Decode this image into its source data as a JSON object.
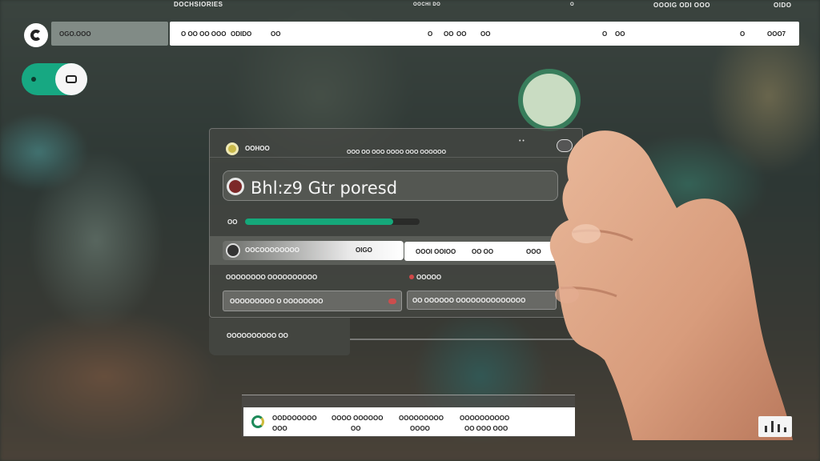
{
  "top_strip": {
    "left_title": "DOCHSIORIES",
    "center_text": "OOCHI DO",
    "center_dot": "O",
    "right_text": "OOOIG ODI OOO",
    "far_right": "OIDO"
  },
  "header": {
    "tag_label": "OGO.OOO",
    "search_segments": [
      "O OO OO OOO",
      "ODIDO",
      "OO",
      "O",
      "OO",
      "OO",
      "OO",
      "O",
      "OO",
      "O",
      "OOO7"
    ]
  },
  "panel": {
    "header_title": "OOHOO",
    "header_meta": "OOO OO OOO OOOO OOO OOOOOO",
    "header_dots": "• •",
    "name_value": "Bhl:z9 Gtr poresd",
    "progress_label": "OO",
    "progress_fraction": 0.85,
    "row1_left_text": "OOCOOOOOOOO",
    "row1_left_suffix": "OIGO",
    "row1_right_segments": [
      "OOOI OOIOO",
      "OO OO",
      "OOO"
    ],
    "label_a": "OOOOOOOO OOOOOOOOOO",
    "label_b": "OOOOO",
    "input_a_text": "OOOOOOOOO  O   OOOOOOOO",
    "input_b_text": "OO OOOOOO OOOOOOOOOOOOOO",
    "bottom_tab_text": "OOOOOOOOOO  OO"
  },
  "footer": {
    "col1_top": "OODOOOOOO",
    "col1_bottom": "OOO",
    "col2_top": "OOOO OOOOOO",
    "col2_bottom": "OO",
    "col3_top": "OOOOOOOOO",
    "col3_bottom": "OOOO",
    "col4_top": "OOOOOOOOOO",
    "col4_bottom": "OO OOO OOO"
  },
  "icons": {
    "logo": "logo-icon",
    "toggle": "toggle-icon",
    "record": "record-icon",
    "chart": "chart-icon"
  },
  "colors": {
    "accent_green": "#15a87a",
    "toggle_green": "#17a882",
    "record_red": "#7c2828",
    "alert_red": "#cc4d4d"
  }
}
